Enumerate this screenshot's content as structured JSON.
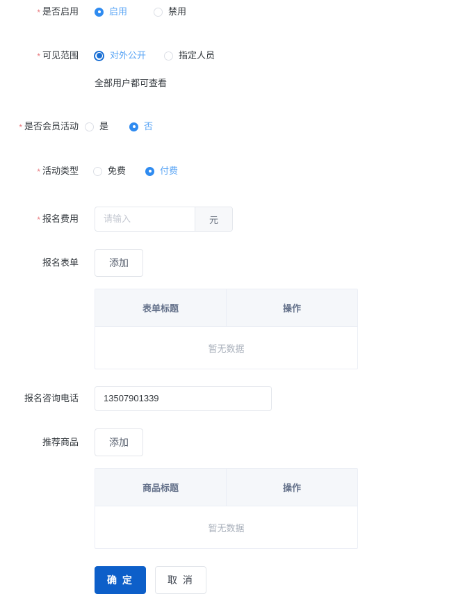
{
  "form": {
    "rows": [
      {
        "label": "是否启用",
        "required": true,
        "options": [
          {
            "label": "启用",
            "selected": true
          },
          {
            "label": "禁用",
            "selected": false
          }
        ]
      },
      {
        "label": "可见范围",
        "required": true,
        "options": [
          {
            "label": "对外公开",
            "selected": true
          },
          {
            "label": "指定人员",
            "selected": false
          }
        ],
        "hint": "全部用户都可查看"
      },
      {
        "label": "是否会员活动",
        "required": true,
        "options": [
          {
            "label": "是",
            "selected": false
          },
          {
            "label": "否",
            "selected": true
          }
        ]
      },
      {
        "label": "活动类型",
        "required": true,
        "options": [
          {
            "label": "免费",
            "selected": false
          },
          {
            "label": "付费",
            "selected": true
          }
        ]
      }
    ],
    "fee": {
      "label": "报名费用",
      "required": true,
      "value": "",
      "placeholder": "请输入",
      "unit": "元"
    },
    "signup_form": {
      "label": "报名表单",
      "required": false,
      "add_button": "添加",
      "table": {
        "columns": [
          "表单标题",
          "操作"
        ],
        "rows": [],
        "empty_text": "暂无数据"
      }
    },
    "phone": {
      "label": "报名咨询电话",
      "required": false,
      "value": "13507901339",
      "placeholder": "请输入"
    },
    "recommend_goods": {
      "label": "推荐商品",
      "required": false,
      "add_button": "添加",
      "table": {
        "columns": [
          "商品标题",
          "操作"
        ],
        "rows": [],
        "empty_text": "暂无数据"
      }
    },
    "footer": {
      "confirm": "确 定",
      "cancel": "取 消"
    }
  },
  "colors": {
    "primary": "#0d5fc9",
    "radio_active": "#2f8bf0",
    "radio_ring": "#1a6fd4",
    "selected_label": "#5aa5f5",
    "required_star": "#e8787d",
    "table_header_bg": "#f5f7fa",
    "border": "#ebeef5"
  }
}
